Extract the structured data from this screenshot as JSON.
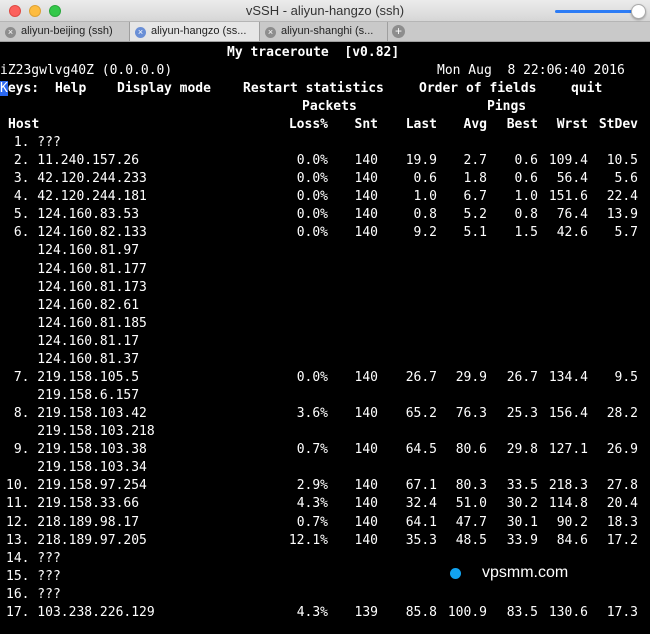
{
  "window": {
    "title": "vSSH - aliyun-hangzo (ssh)"
  },
  "tabs": [
    {
      "label": "aliyun-beijing (ssh)",
      "close": "×"
    },
    {
      "label": "aliyun-hangzo (ss...",
      "close": "×"
    },
    {
      "label": "aliyun-shanghi (s...",
      "close": "×"
    }
  ],
  "add_tab": "+",
  "terminal": {
    "app_title": "My traceroute  [v0.82]",
    "hostname": "iZ23gwlvg40Z (0.0.0.0)",
    "datetime": "Mon Aug  8 22:06:40 2016",
    "keys": {
      "cursor_char": "K",
      "keys_rest": "eys:",
      "help_key": "H",
      "help_rest": "elp",
      "display_key": "D",
      "display_rest": "isplay mode",
      "restart_key": "R",
      "restart_rest": "estart statistics",
      "order_key": "O",
      "order_rest": "rder of fields",
      "quit_key": "q",
      "quit_rest": "uit"
    },
    "group_headers": {
      "packets": "Packets",
      "pings": "Pings"
    },
    "columns": {
      "host": "Host",
      "loss": "Loss%",
      "snt": "Snt",
      "last": "Last",
      "avg": "Avg",
      "best": "Best",
      "wrst": "Wrst",
      "stdev": "StDev"
    },
    "rows": [
      {
        "host": " 1. ???"
      },
      {
        "host": " 2. 11.240.157.26",
        "loss": "0.0%",
        "snt": "140",
        "last": "19.9",
        "avg": "2.7",
        "best": "0.6",
        "wrst": "109.4",
        "stdev": "10.5"
      },
      {
        "host": " 3. 42.120.244.233",
        "loss": "0.0%",
        "snt": "140",
        "last": "0.6",
        "avg": "1.8",
        "best": "0.6",
        "wrst": "56.4",
        "stdev": "5.6"
      },
      {
        "host": " 4. 42.120.244.181",
        "loss": "0.0%",
        "snt": "140",
        "last": "1.0",
        "avg": "6.7",
        "best": "1.0",
        "wrst": "151.6",
        "stdev": "22.4"
      },
      {
        "host": " 5. 124.160.83.53",
        "loss": "0.0%",
        "snt": "140",
        "last": "0.8",
        "avg": "5.2",
        "best": "0.8",
        "wrst": "76.4",
        "stdev": "13.9"
      },
      {
        "host": " 6. 124.160.82.133",
        "loss": "0.0%",
        "snt": "140",
        "last": "9.2",
        "avg": "5.1",
        "best": "1.5",
        "wrst": "42.6",
        "stdev": "5.7"
      },
      {
        "host": "    124.160.81.97"
      },
      {
        "host": "    124.160.81.177"
      },
      {
        "host": "    124.160.81.173"
      },
      {
        "host": "    124.160.82.61"
      },
      {
        "host": "    124.160.81.185"
      },
      {
        "host": "    124.160.81.17"
      },
      {
        "host": "    124.160.81.37"
      },
      {
        "host": " 7. 219.158.105.5",
        "loss": "0.0%",
        "snt": "140",
        "last": "26.7",
        "avg": "29.9",
        "best": "26.7",
        "wrst": "134.4",
        "stdev": "9.5"
      },
      {
        "host": "    219.158.6.157"
      },
      {
        "host": " 8. 219.158.103.42",
        "loss": "3.6%",
        "snt": "140",
        "last": "65.2",
        "avg": "76.3",
        "best": "25.3",
        "wrst": "156.4",
        "stdev": "28.2"
      },
      {
        "host": "    219.158.103.218"
      },
      {
        "host": " 9. 219.158.103.38",
        "loss": "0.7%",
        "snt": "140",
        "last": "64.5",
        "avg": "80.6",
        "best": "29.8",
        "wrst": "127.1",
        "stdev": "26.9"
      },
      {
        "host": "    219.158.103.34"
      },
      {
        "host": "10. 219.158.97.254",
        "loss": "2.9%",
        "snt": "140",
        "last": "67.1",
        "avg": "80.3",
        "best": "33.5",
        "wrst": "218.3",
        "stdev": "27.8"
      },
      {
        "host": "11. 219.158.33.66",
        "loss": "4.3%",
        "snt": "140",
        "last": "32.4",
        "avg": "51.0",
        "best": "30.2",
        "wrst": "114.8",
        "stdev": "20.4"
      },
      {
        "host": "12. 218.189.98.17",
        "loss": "0.7%",
        "snt": "140",
        "last": "64.1",
        "avg": "47.7",
        "best": "30.1",
        "wrst": "90.2",
        "stdev": "18.3"
      },
      {
        "host": "13. 218.189.97.205",
        "loss": "12.1%",
        "snt": "140",
        "last": "35.3",
        "avg": "48.5",
        "best": "33.9",
        "wrst": "84.6",
        "stdev": "17.2"
      },
      {
        "host": "14. ???"
      },
      {
        "host": "15. ???"
      },
      {
        "host": "16. ???"
      },
      {
        "host": "17. 103.238.226.129",
        "loss": "4.3%",
        "snt": "139",
        "last": "85.8",
        "avg": "100.9",
        "best": "83.5",
        "wrst": "130.6",
        "stdev": "17.3"
      }
    ]
  },
  "watermark": {
    "text": "vpsmm.com",
    "dot_color": "#12a4f2"
  }
}
